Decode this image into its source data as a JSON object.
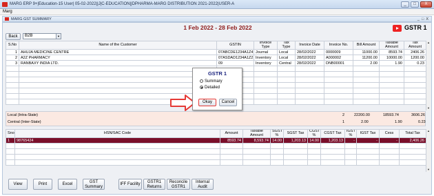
{
  "window": {
    "title": "MARG ERP 9+|Education-15 User| 05-02-2022||J|C-EDUCATION||DPHARMA-MARG DISTRIBUTION 2021-2022|USER-A",
    "controls": [
      "_",
      "□",
      "X"
    ]
  },
  "menu": {
    "items": [
      "Marg"
    ]
  },
  "inner_window": {
    "title": "MARG GST SUMMARY",
    "controls": [
      "_",
      "□",
      "X"
    ]
  },
  "date_range": "1 Feb 2022 - 28 Feb 2022",
  "badge": {
    "label": "GSTR 1",
    "icon": "youtube-play-icon"
  },
  "back_button": "Back",
  "type_select": {
    "value": "B2B"
  },
  "invoice_table": {
    "headers": [
      "S.No",
      "Name of the Customer",
      "GSTIN",
      "Invoice Type",
      "Tax Type",
      "Invoice Date",
      "Invoice No.",
      "Bill Amount",
      "Taxable Amount",
      "Tax Amount"
    ],
    "rows": [
      [
        "1",
        "AHUJA MEDICINE CENTRE",
        "07ABCDE1234A1Z4",
        "Journal",
        "Local",
        "28/02/2022",
        "0000009",
        "11000.00",
        "8593.74",
        "2406.26"
      ],
      [
        "2",
        "A2Z PHARMACY",
        "07ASDAD1234A1Z2",
        "Inventory",
        "Local",
        "28/02/2022",
        "A000002",
        "11200.00",
        "10000.00",
        "1200.00"
      ],
      [
        "3",
        "RANBAXY INDIA LTD.",
        "09",
        "Inventory",
        "Central",
        "28/02/2022",
        "DNB00001",
        "2.00",
        "1.90",
        "0.23"
      ]
    ]
  },
  "summary": [
    {
      "label": "Local (Intra-State)",
      "count": "2",
      "bill": "22200.00",
      "taxable": "18593.74",
      "tax": "3606.26"
    },
    {
      "label": "Central (Inter-State)",
      "count": "1",
      "bill": "2.00",
      "taxable": "1.90",
      "tax": "0.23"
    }
  ],
  "hsn_table": {
    "headers": [
      "Sno",
      "HSN/SAC Code",
      "Amount",
      "Taxable Amount",
      "SGST %",
      "SGST Tax",
      "CGST %",
      "CGST Tax",
      "IGST %",
      "IGST Tax",
      "Cess",
      "Total Tax"
    ],
    "rows": [
      [
        "1",
        "98765424",
        "8593.74",
        "8,593.74",
        "14.00",
        "1,203.13",
        "14.00",
        "1,203.13",
        "-",
        "-",
        "-",
        "2,406.26"
      ]
    ]
  },
  "bottom_buttons": [
    "View",
    "Print",
    "Excel",
    "GST Summary",
    "IFF Facility",
    "GSTR1 Returns",
    "Reconcile GSTR1",
    "Internal Audit"
  ],
  "dialog": {
    "title": "GSTR 1",
    "options": [
      {
        "label": "Summary",
        "selected": false
      },
      {
        "label": "Detailed",
        "selected": true
      }
    ],
    "ok": "Okay",
    "cancel": "Cancel"
  },
  "colors": {
    "highlight_row": "#7a0f2a",
    "date_text": "#8e1b1b",
    "callout_arrow": "#e53935"
  }
}
